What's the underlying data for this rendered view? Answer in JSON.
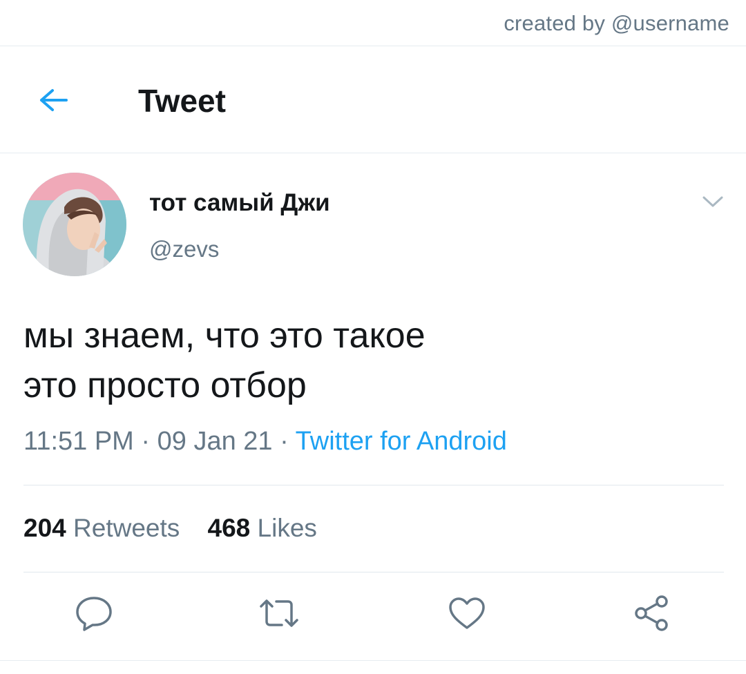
{
  "top_bar": {
    "created_by": "created by @username"
  },
  "header": {
    "back_icon": "arrow-left-icon",
    "title": "Tweet"
  },
  "tweet": {
    "author": {
      "display_name": "тот самый Джи",
      "handle": "@zevs"
    },
    "menu_icon": "chevron-down-icon",
    "text_lines": [
      "мы знаем, что это такое",
      "это просто отбор"
    ],
    "meta": {
      "time": "11:51 PM",
      "separator": " · ",
      "date": "09 Jan 21",
      "source": "Twitter for Android"
    },
    "stats": {
      "retweets": {
        "count": "204",
        "label": "Retweets"
      },
      "likes": {
        "count": "468",
        "label": "Likes"
      }
    },
    "actions": [
      {
        "name": "reply",
        "icon": "reply-bubble-icon"
      },
      {
        "name": "retweet",
        "icon": "retweet-icon"
      },
      {
        "name": "like",
        "icon": "heart-icon"
      },
      {
        "name": "share",
        "icon": "share-icon"
      }
    ]
  },
  "colors": {
    "accent": "#1da1f2",
    "text_primary": "#14171a",
    "text_secondary": "#657786",
    "divider": "#e1e8ed",
    "icon_gray": "#657786"
  }
}
